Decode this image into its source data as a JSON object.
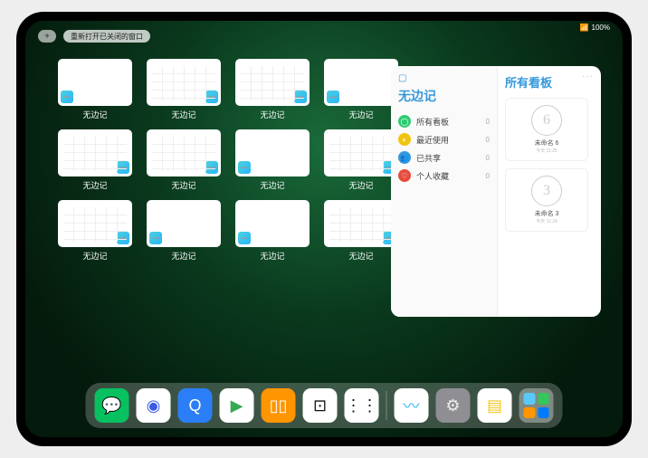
{
  "status": {
    "wifi": "📶",
    "battery": "100%"
  },
  "topbar": {
    "plus": "+",
    "reopen": "重新打开已关闭的窗口"
  },
  "app_name": "无边记",
  "windows": [
    {
      "label": "无边记",
      "style": "blank"
    },
    {
      "label": "无边记",
      "style": "calendar"
    },
    {
      "label": "无边记",
      "style": "calendar"
    },
    {
      "label": "无边记",
      "style": "blank"
    },
    {
      "label": "无边记",
      "style": "calendar"
    },
    {
      "label": "无边记",
      "style": "calendar"
    },
    {
      "label": "无边记",
      "style": "blank"
    },
    {
      "label": "无边记",
      "style": "calendar"
    },
    {
      "label": "无边记",
      "style": "calendar"
    },
    {
      "label": "无边记",
      "style": "blank"
    },
    {
      "label": "无边记",
      "style": "blank"
    },
    {
      "label": "无边记",
      "style": "calendar"
    }
  ],
  "panel": {
    "app_icon": "▢",
    "more": "···",
    "left_title": "无边记",
    "menu": [
      {
        "icon": "◯",
        "color": "#2ecc71",
        "label": "所有看板",
        "count": "0"
      },
      {
        "icon": "◐",
        "color": "#f1c40f",
        "label": "最近使用",
        "count": "0"
      },
      {
        "icon": "👥",
        "color": "#3498db",
        "label": "已共享",
        "count": "0"
      },
      {
        "icon": "♡",
        "color": "#e74c3c",
        "label": "个人收藏",
        "count": "0"
      }
    ],
    "right_title": "所有看板",
    "boards": [
      {
        "glyph": "6",
        "label": "未命名 6",
        "sub": "今天 11:25"
      },
      {
        "glyph": "3",
        "label": "未命名 3",
        "sub": "今天 11:24"
      }
    ]
  },
  "dock": {
    "apps": [
      {
        "name": "wechat",
        "bg": "#07c160",
        "glyph": "💬"
      },
      {
        "name": "quark",
        "bg": "#ffffff",
        "glyph": "◉",
        "fg": "#3b5be6"
      },
      {
        "name": "qqbrowser",
        "bg": "#2b7ef5",
        "glyph": "Q",
        "fg": "#fff"
      },
      {
        "name": "play",
        "bg": "#ffffff",
        "glyph": "▶",
        "fg": "#34a853"
      },
      {
        "name": "books",
        "bg": "#ff9500",
        "glyph": "▯▯",
        "fg": "#fff"
      },
      {
        "name": "dice",
        "bg": "#ffffff",
        "glyph": "⊡",
        "fg": "#111"
      },
      {
        "name": "connect",
        "bg": "#ffffff",
        "glyph": "⋮⋮",
        "fg": "#111"
      },
      {
        "name": "freeform",
        "bg": "#ffffff",
        "glyph": "〰",
        "fg": "#29b6f6"
      },
      {
        "name": "settings",
        "bg": "#8e8e93",
        "glyph": "⚙",
        "fg": "#eee"
      },
      {
        "name": "notes",
        "bg": "#ffffff",
        "glyph": "▤",
        "fg": "#f5c518"
      }
    ]
  }
}
